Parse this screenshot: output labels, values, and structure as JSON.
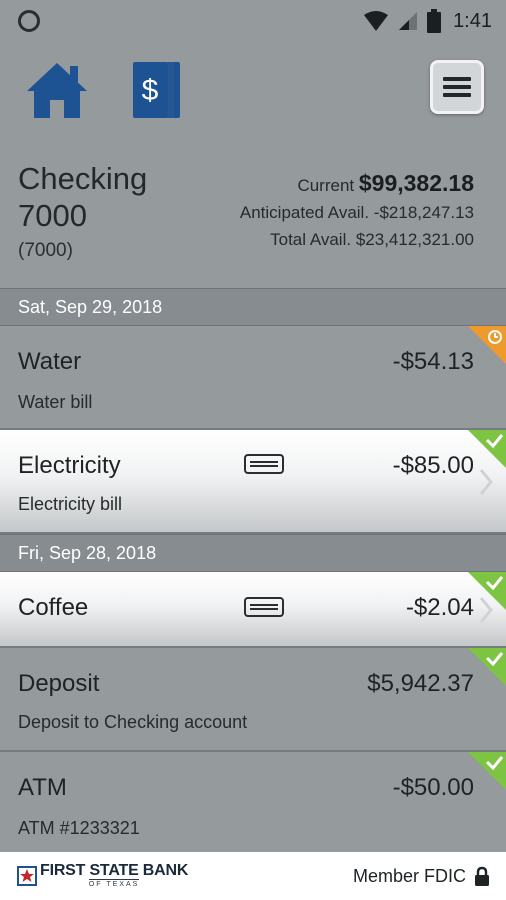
{
  "status_bar": {
    "time": "1:41"
  },
  "account": {
    "name": "Checking 7000",
    "number": "(7000)",
    "current_label": "Current",
    "current_value": "$99,382.18",
    "anticipated_label": "Anticipated Avail.",
    "anticipated_value": "-$218,247.13",
    "total_label": "Total Avail.",
    "total_value": "$23,412,321.00"
  },
  "groups": [
    {
      "date": "Sat, Sep 29, 2018",
      "transactions": [
        {
          "title": "Water",
          "amount": "-$54.13",
          "description": "Water bill",
          "status": "pending"
        },
        {
          "title": "Electricity",
          "amount": "-$85.00",
          "description": "Electricity bill",
          "status": "cleared"
        }
      ]
    },
    {
      "date": "Fri, Sep 28, 2018",
      "transactions": [
        {
          "title": "Coffee",
          "amount": "-$2.04",
          "description": "",
          "status": "cleared"
        },
        {
          "title": "Deposit",
          "amount": "$5,942.37",
          "description": "Deposit to Checking account",
          "status": "cleared"
        },
        {
          "title": "ATM",
          "amount": "-$50.00",
          "description": "ATM #1233321",
          "status": "cleared"
        }
      ]
    }
  ],
  "footer": {
    "logo_main": "FIRST STATE BANK",
    "logo_sub": "OF TEXAS",
    "member_text": "Member FDIC"
  },
  "icons": {
    "home": "home-icon",
    "accounts": "dollar-cards-icon",
    "menu": "hamburger-menu-icon",
    "card": "card-icon",
    "pending": "clock-icon",
    "cleared": "check-icon",
    "lock": "lock-icon"
  },
  "colors": {
    "brand_blue": "#1d5393",
    "pending_orange": "#ef9a2c",
    "cleared_green": "#7dc442",
    "background": "#959a9d"
  }
}
